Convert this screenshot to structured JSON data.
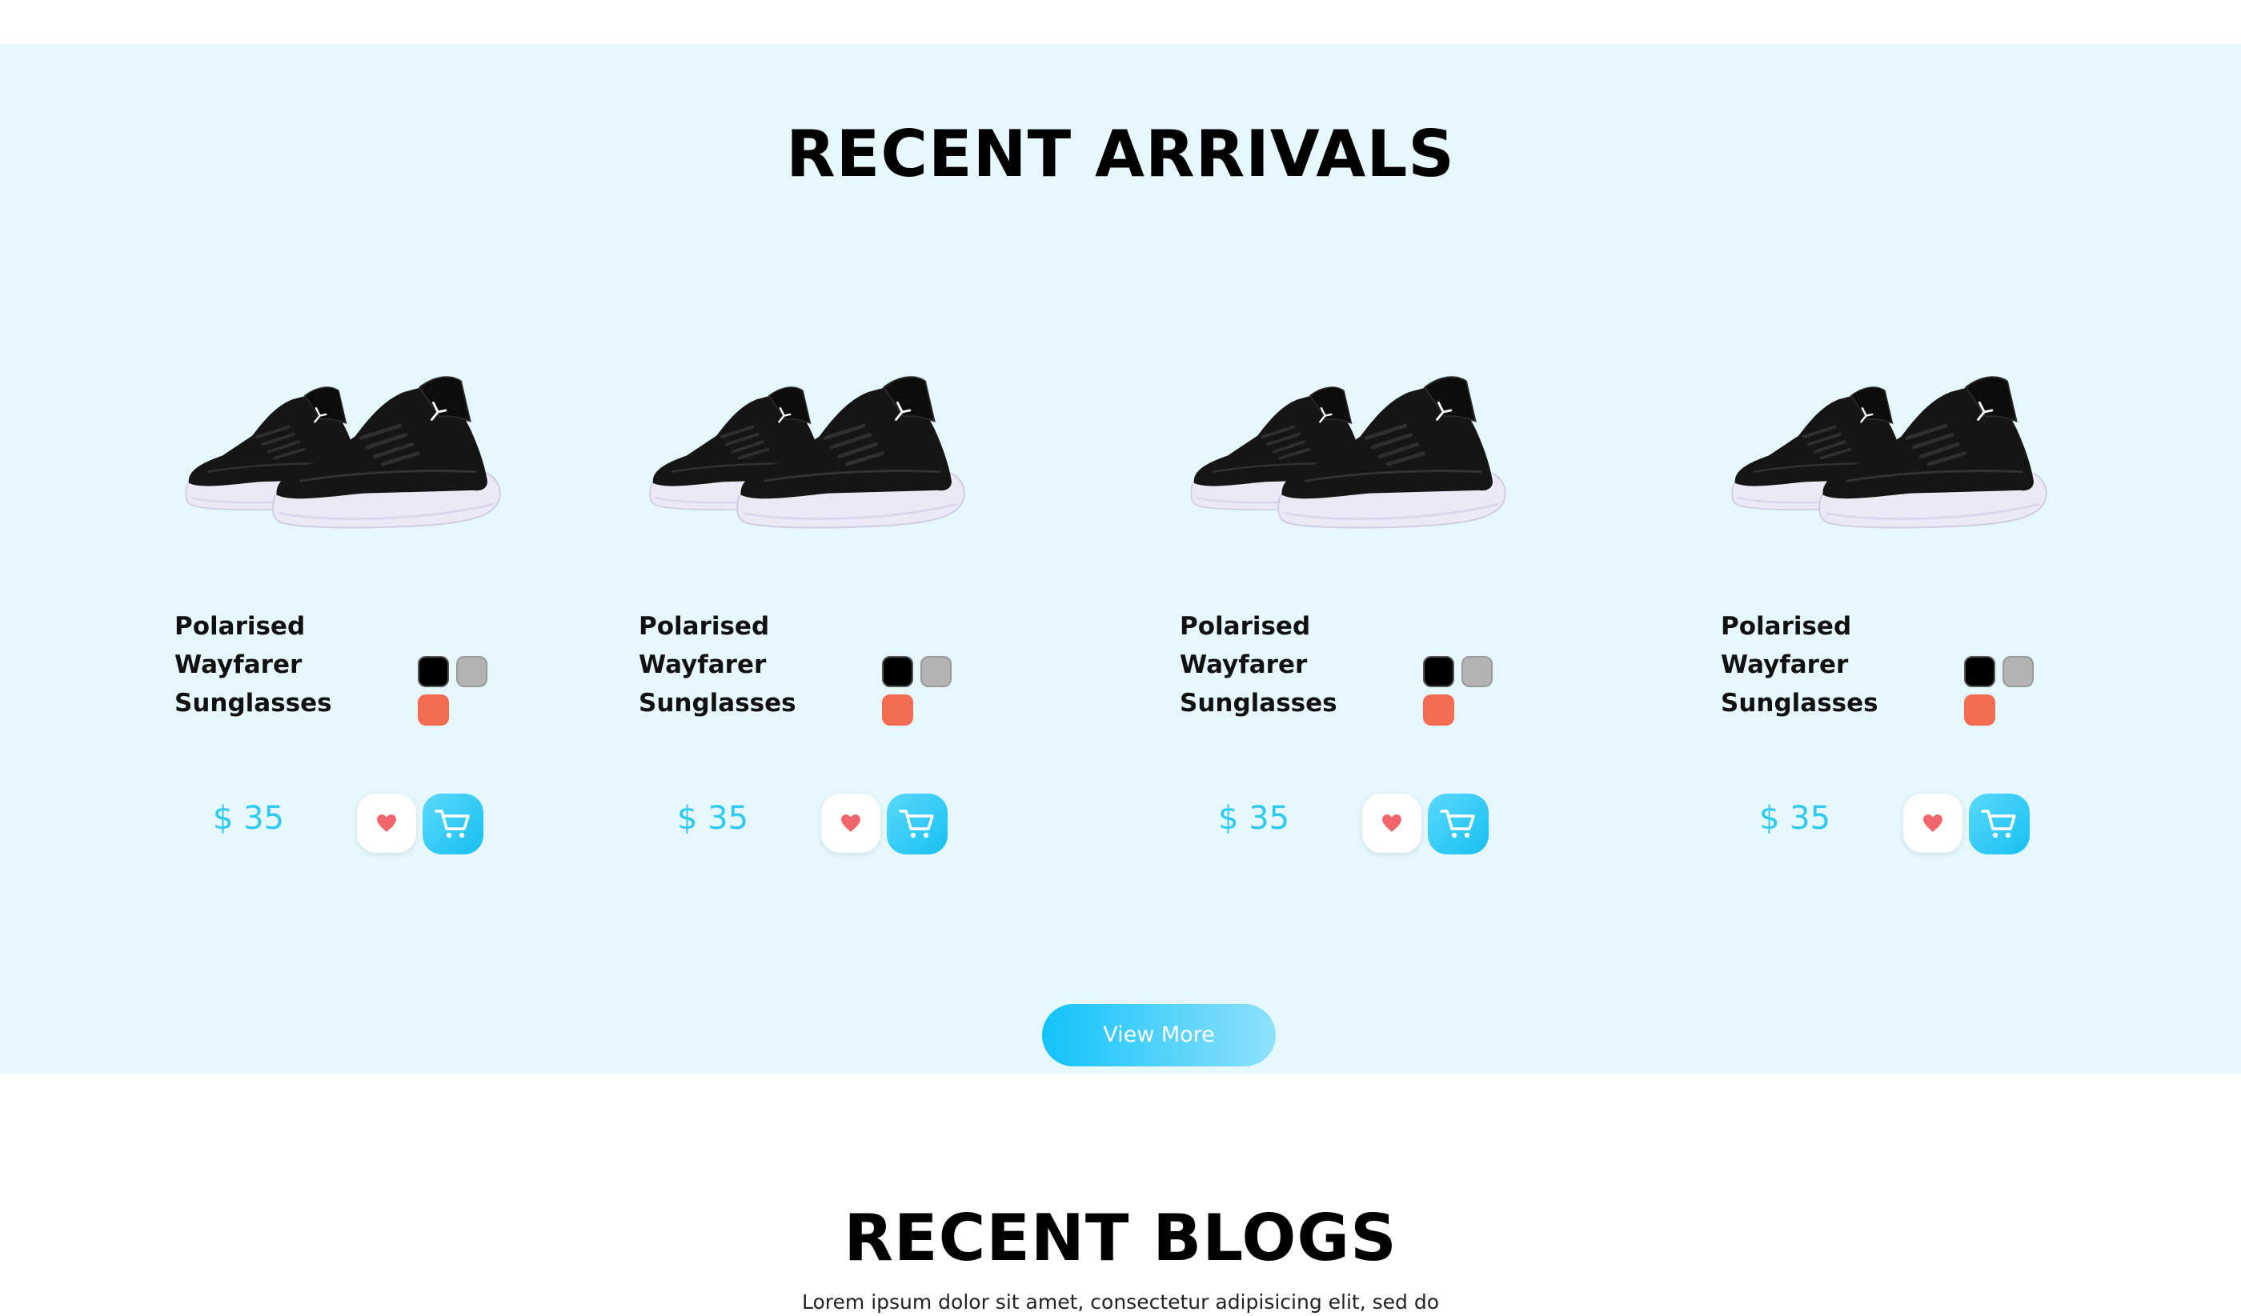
{
  "recent_arrivals": {
    "title": "RECENT ARRIVALS",
    "products": [
      {
        "name_lines": [
          "Polarised",
          "Wayfarer",
          "Sunglasses"
        ],
        "price": "$ 35",
        "colors": [
          "#000000",
          "#b3b3b3",
          "#f26b52"
        ],
        "image_icon": "sneaker-pair-icon"
      },
      {
        "name_lines": [
          "Polarised",
          "Wayfarer",
          "Sunglasses"
        ],
        "price": "$ 35",
        "colors": [
          "#000000",
          "#b3b3b3",
          "#f26b52"
        ],
        "image_icon": "sneaker-pair-icon"
      },
      {
        "name_lines": [
          "Polarised",
          "Wayfarer",
          "Sunglasses"
        ],
        "price": "$ 35",
        "colors": [
          "#000000",
          "#b3b3b3",
          "#f26b52"
        ],
        "image_icon": "sneaker-pair-icon"
      },
      {
        "name_lines": [
          "Polarised",
          "Wayfarer",
          "Sunglasses"
        ],
        "price": "$ 35",
        "colors": [
          "#000000",
          "#b3b3b3",
          "#f26b52"
        ],
        "image_icon": "sneaker-pair-icon"
      }
    ],
    "view_more_label": "View More",
    "wishlist_icon": "heart-icon",
    "cart_icon": "cart-icon"
  },
  "recent_blogs": {
    "title": "RECENT BLOGS",
    "intro": "Lorem ipsum dolor sit amet, consectetur adipisicing elit, sed do"
  },
  "theme": {
    "section_background": "#e6f8fd",
    "accent": "#2ec9f3",
    "heart": "#f0646c"
  }
}
